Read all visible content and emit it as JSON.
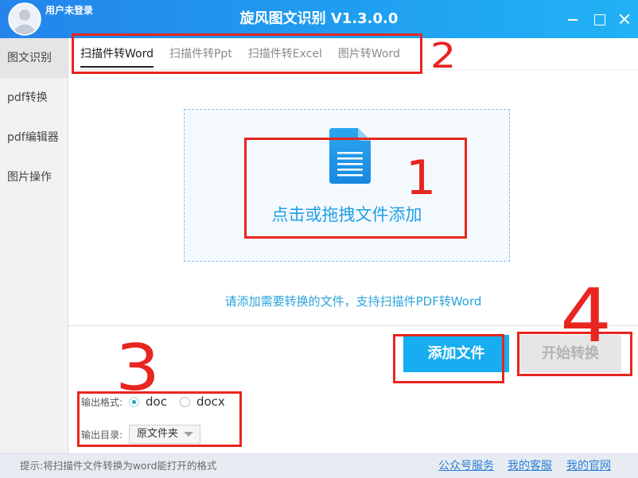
{
  "window": {
    "title": "旋风图文识别 V1.3.0.0",
    "user_status": "用户未登录",
    "avatar_icon": "user-avatar-icon",
    "controls": [
      "minimize-icon",
      "maximize-icon",
      "close-icon"
    ]
  },
  "sidebar": {
    "items": [
      {
        "label": "图文识别",
        "active": true
      },
      {
        "label": "pdf转换",
        "active": false
      },
      {
        "label": "pdf编辑器",
        "active": false
      },
      {
        "label": "图片操作",
        "active": false
      }
    ]
  },
  "tabs": [
    {
      "label": "扫描件转Word",
      "active": true
    },
    {
      "label": "扫描件转Ppt",
      "active": false
    },
    {
      "label": "扫描件转Excel",
      "active": false
    },
    {
      "label": "图片转Word",
      "active": false
    }
  ],
  "dropzone": {
    "icon": "document-icon",
    "label": "点击或拖拽文件添加"
  },
  "hint": "请添加需要转换的文件，支持扫描件PDF转Word",
  "actions": {
    "add_label": "添加文件",
    "start_label": "开始转换",
    "start_disabled": true
  },
  "output": {
    "format_label": "输出格式:",
    "formats": [
      {
        "label": "doc",
        "selected": true
      },
      {
        "label": "docx",
        "selected": false
      }
    ],
    "dir_label": "输出目录:",
    "dir_value": "原文件夹"
  },
  "statusbar": {
    "tip": "提示:将扫描件文件转换为word能打开的格式",
    "links": [
      "公众号服务",
      "我的客服",
      "我的官网"
    ]
  },
  "annotations": {
    "marker_1": "1",
    "marker_2": "2",
    "marker_3": "3",
    "marker_4": "4"
  },
  "colors": {
    "titlebar_start": "#2484ea",
    "titlebar_end": "#22b2f5",
    "accent_button": "#17adf0",
    "drop_text": "#1f9ee5",
    "link": "#2b7ed6",
    "annotation": "#e8251f"
  }
}
